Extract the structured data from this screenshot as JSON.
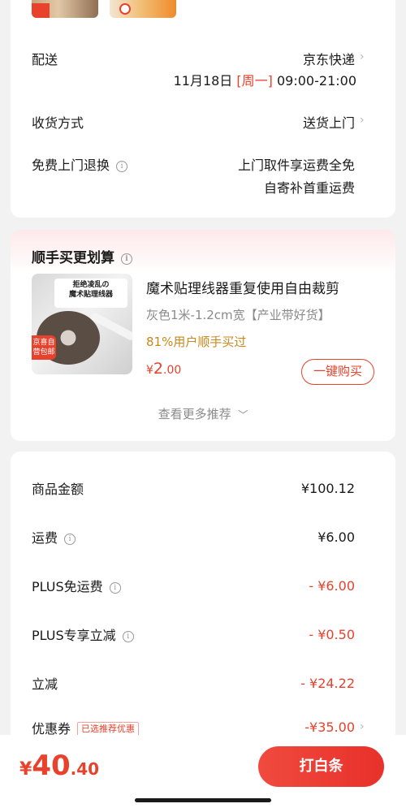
{
  "delivery": {
    "label": "配送",
    "carrier": "京东快递",
    "date": "11月18日",
    "weekday": "[周一]",
    "time_window": "09:00-21:00"
  },
  "receive_method": {
    "label": "收货方式",
    "value": "送货上门"
  },
  "free_return": {
    "label": "免费上门退换",
    "line1": "上门取件享运费全免",
    "line2": "自寄补首重运费"
  },
  "addon": {
    "title": "顺手买更划算",
    "product": {
      "name": "魔术贴理线器重复使用自由裁剪",
      "spec": "灰色1米-1.2cm宽【产业带好货】",
      "hint": "81%用户顺手买过",
      "price_symbol": "¥",
      "price_int": "2",
      "price_dec": ".00",
      "image_banner_line1": "拒绝凌乱の",
      "image_banner_line2": "魔术贴理线器",
      "image_badge": "京喜自营包邮"
    },
    "buy_label": "一键购买",
    "more_label": "查看更多推荐"
  },
  "price_breakdown": {
    "rows": [
      {
        "label": "商品金额",
        "value": "¥100.12"
      },
      {
        "label": "运费",
        "value": "¥6.00"
      },
      {
        "label": "PLUS免运费",
        "value": "- ¥6.00"
      },
      {
        "label": "PLUS专享立减",
        "value": "- ¥0.50"
      },
      {
        "label": "立减",
        "value": "- ¥24.22"
      },
      {
        "label": "优惠券",
        "value": "-¥35.00",
        "tag": "已选推荐优惠"
      }
    ]
  },
  "bottom": {
    "total_symbol": "¥",
    "total_int": "40",
    "total_dec": ".40",
    "pay_label": "打白条"
  },
  "colors": {
    "accent": "#e8412c",
    "hint": "#c9871c",
    "muted": "#8a8a8a"
  }
}
